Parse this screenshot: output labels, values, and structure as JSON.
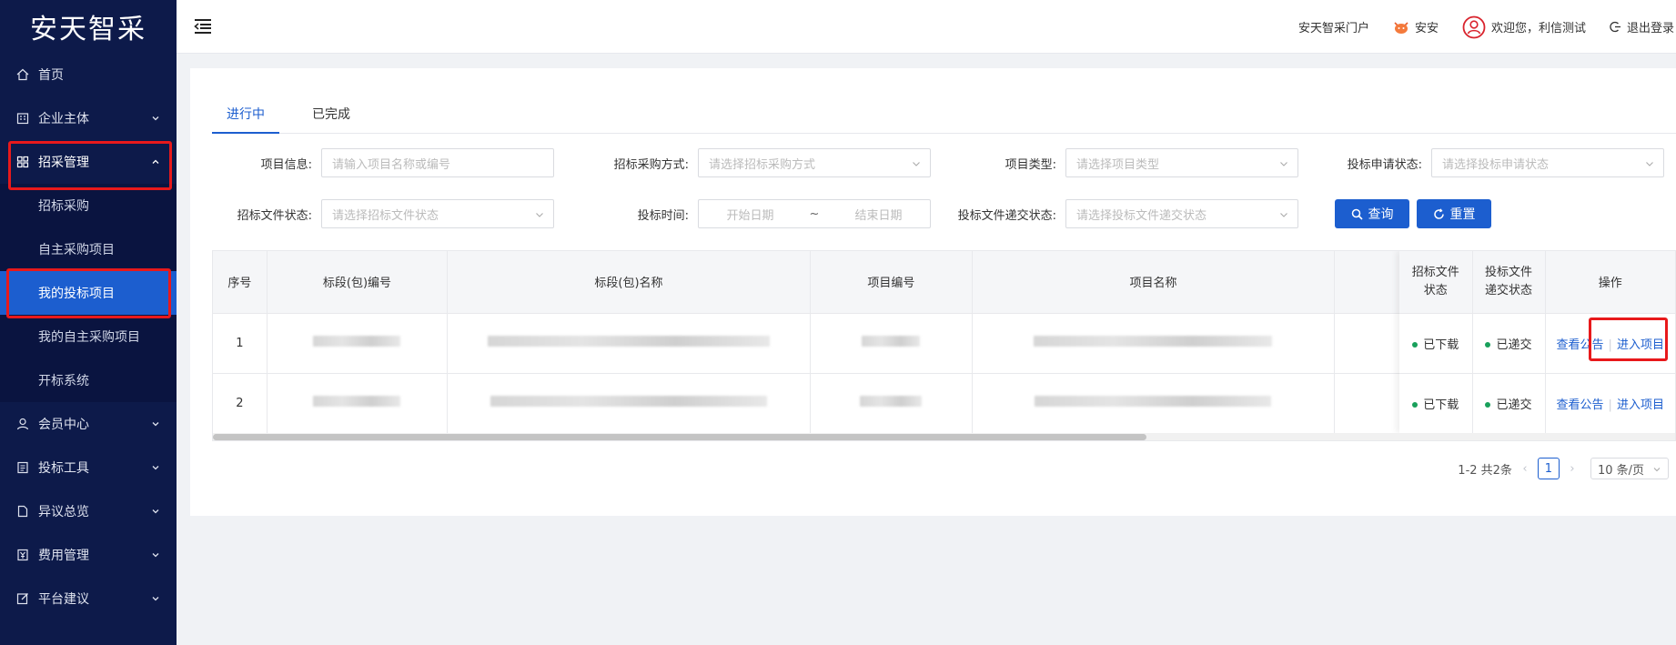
{
  "sidebar": {
    "logo": "安天智采",
    "items": [
      {
        "label": "首页"
      },
      {
        "label": "企业主体"
      },
      {
        "label": "招采管理"
      },
      {
        "label": "会员中心"
      },
      {
        "label": "投标工具"
      },
      {
        "label": "异议总览"
      },
      {
        "label": "费用管理"
      },
      {
        "label": "平台建议"
      }
    ],
    "sub_items": [
      {
        "label": "招标采购"
      },
      {
        "label": "自主采购项目"
      },
      {
        "label": "我的投标项目"
      },
      {
        "label": "我的自主采购项目"
      },
      {
        "label": "开标系统"
      }
    ]
  },
  "header": {
    "portal": "安天智采门户",
    "assistant": "安安",
    "welcome": "欢迎您，利信测试",
    "logout": "退出登录"
  },
  "tabs": [
    {
      "label": "进行中"
    },
    {
      "label": "已完成"
    }
  ],
  "filters": {
    "project_info": {
      "label": "项目信息:",
      "placeholder": "请输入项目名称或编号"
    },
    "method": {
      "label": "招标采购方式:",
      "placeholder": "请选择招标采购方式"
    },
    "type": {
      "label": "项目类型:",
      "placeholder": "请选择项目类型"
    },
    "apply_status": {
      "label": "投标申请状态:",
      "placeholder": "请选择投标申请状态"
    },
    "doc_status": {
      "label": "招标文件状态:",
      "placeholder": "请选择招标文件状态"
    },
    "bid_time": {
      "label": "投标时间:",
      "start": "开始日期",
      "sep": "~",
      "end": "结束日期"
    },
    "submit_status": {
      "label": "投标文件递交状态:",
      "placeholder": "请选择投标文件递交状态"
    },
    "search_btn": "查询",
    "reset_btn": "重置"
  },
  "table": {
    "headers": {
      "index": "序号",
      "section_no": "标段(包)编号",
      "section_name": "标段(包)名称",
      "project_no": "项目编号",
      "project_name": "项目名称",
      "doc_status": "招标文件状态",
      "submit_status": "投标文件递交状态",
      "actions": "操作"
    },
    "rows": [
      {
        "index": "1",
        "doc_status": "已下载",
        "submit_status": "已递交",
        "view": "查看公告",
        "enter": "进入项目"
      },
      {
        "index": "2",
        "doc_status": "已下载",
        "submit_status": "已递交",
        "view": "查看公告",
        "enter": "进入项目"
      }
    ]
  },
  "pagination": {
    "summary": "1-2 共2条",
    "current": "1",
    "page_size": "10 条/页"
  },
  "colors": {
    "primary": "#1c5ecf",
    "sidebar_bg": "#0d1a4a",
    "highlight": "#e8191b",
    "status_green": "#19a05b"
  }
}
